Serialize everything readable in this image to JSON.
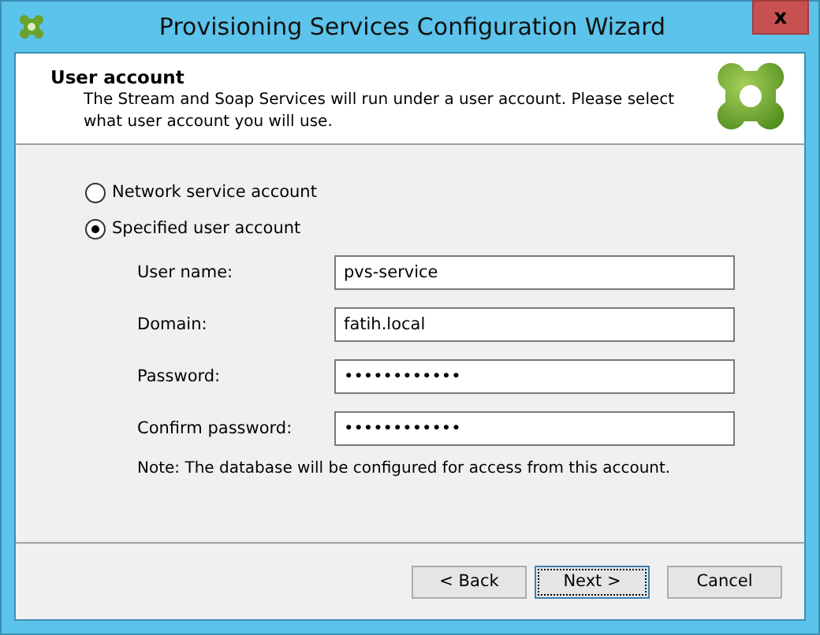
{
  "window": {
    "title": "Provisioning Services Configuration Wizard",
    "close": "x"
  },
  "header": {
    "title": "User account",
    "description": "The Stream and Soap Services will run under a user account. Please select what user account you will use."
  },
  "account_options": [
    {
      "label": "Network service account",
      "selected": false
    },
    {
      "label": "Specified user account",
      "selected": true
    }
  ],
  "fields": [
    {
      "label": "User name:",
      "value": "pvs-service"
    },
    {
      "label": "Domain:",
      "value": "fatih.local"
    },
    {
      "label": "Password:",
      "value": "••••••••••••"
    },
    {
      "label": "Confirm password:",
      "value": "••••••••••••"
    }
  ],
  "note": "Note: The database will be configured for access from this account.",
  "buttons": [
    {
      "label": "< Back",
      "default": false
    },
    {
      "label": "Next >",
      "default": true
    },
    {
      "label": "Cancel",
      "default": false
    }
  ]
}
